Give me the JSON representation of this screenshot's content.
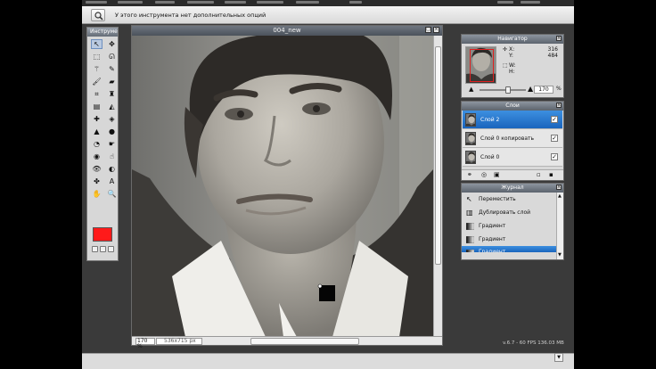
{
  "options_bar": {
    "message": "У этого инструмента нет дополнительных опций"
  },
  "tools_panel": {
    "title": "Инструмент",
    "tools": [
      {
        "icon": "arrow-icon",
        "glyph": "↖"
      },
      {
        "icon": "move-icon",
        "glyph": "✥"
      },
      {
        "icon": "marquee-icon",
        "glyph": "⬚"
      },
      {
        "icon": "lasso-icon",
        "glyph": "ᘏ"
      },
      {
        "icon": "wand-icon",
        "glyph": "⚚"
      },
      {
        "icon": "pencil-icon",
        "glyph": "✎"
      },
      {
        "icon": "brush-icon",
        "glyph": "🖌"
      },
      {
        "icon": "eraser-icon",
        "glyph": "▰"
      },
      {
        "icon": "crop-icon",
        "glyph": "⌗"
      },
      {
        "icon": "stamp-icon",
        "glyph": "♜"
      },
      {
        "icon": "gradient-icon",
        "glyph": "▤"
      },
      {
        "icon": "bucket-icon",
        "glyph": "◭"
      },
      {
        "icon": "heal-icon",
        "glyph": "✚"
      },
      {
        "icon": "colorreplace-icon",
        "glyph": "◈"
      },
      {
        "icon": "blur-icon",
        "glyph": "▲"
      },
      {
        "icon": "drop-icon",
        "glyph": "●"
      },
      {
        "icon": "dodge-icon",
        "glyph": "◔"
      },
      {
        "icon": "burn-icon",
        "glyph": "☛"
      },
      {
        "icon": "sponge-icon",
        "glyph": "◉"
      },
      {
        "icon": "smudge-icon",
        "glyph": "☝"
      },
      {
        "icon": "redeye-icon",
        "glyph": "👁"
      },
      {
        "icon": "bloat-icon",
        "glyph": "◐"
      },
      {
        "icon": "pinch-icon",
        "glyph": "✤"
      },
      {
        "icon": "text-icon",
        "glyph": "A"
      },
      {
        "icon": "hand-icon",
        "glyph": "✋"
      },
      {
        "icon": "zoom-icon",
        "glyph": "🔍"
      }
    ],
    "foreground_color": "#ff1a1a"
  },
  "document": {
    "title": "004_new",
    "zoom": "170 %",
    "size": "536x715 px"
  },
  "navigator": {
    "title": "Навигатор",
    "x_label": "X:",
    "x_value": "316",
    "y_label": "Y:",
    "y_value": "484",
    "w_label": "W:",
    "h_label": "H:",
    "zoom_value": "170"
  },
  "layers": {
    "title": "Слои",
    "items": [
      {
        "name": "Слой 2",
        "selected": true
      },
      {
        "name": "Слой 0 копировать",
        "selected": false
      },
      {
        "name": "Слой 0",
        "selected": false
      }
    ]
  },
  "journal": {
    "title": "Журнал",
    "items": [
      {
        "label": "Переместить",
        "icon": "move-icon"
      },
      {
        "label": "Дублировать слой",
        "icon": "duplicate-icon"
      },
      {
        "label": "Градиент",
        "icon": "gradient-icon"
      },
      {
        "label": "Градиент",
        "icon": "gradient-icon"
      },
      {
        "label": "Градиент",
        "icon": "gradient-icon"
      }
    ]
  },
  "footer": {
    "version": "v.6.7 - 60 FPS 136.03 MB"
  }
}
